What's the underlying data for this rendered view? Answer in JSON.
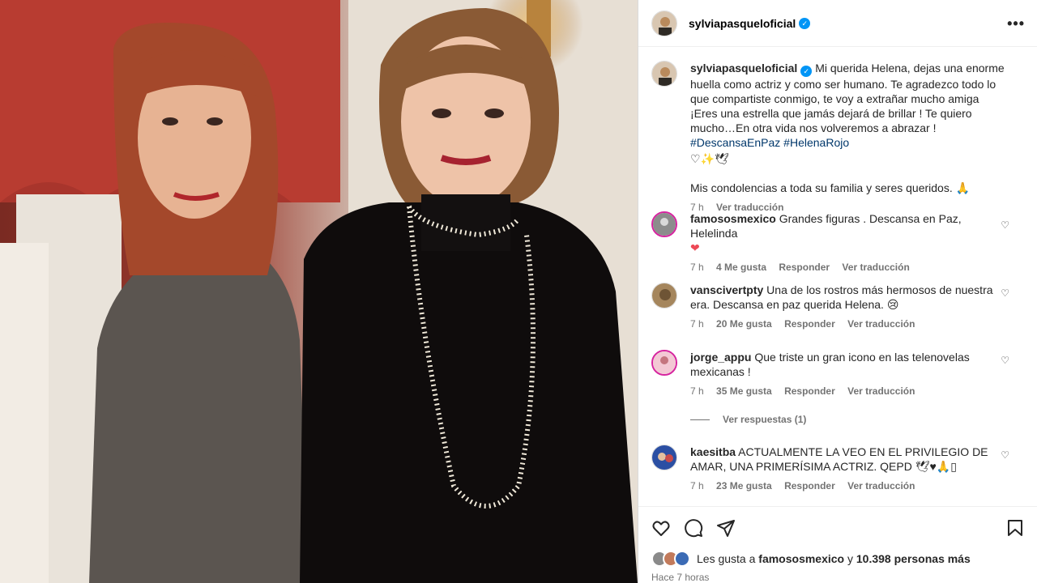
{
  "post": {
    "author": "sylviapasqueloficial",
    "verified_glyph": "✓",
    "more_label": "•••",
    "caption": {
      "text": "Mi querida Helena, dejas una enorme huella como actriz y como ser humano. Te agradezco todo lo que compartiste conmigo, te voy a extrañar mucho amiga ¡Eres una estrella que jamás dejará de brillar ! Te quiero mucho…En otra vida nos volveremos a abrazar !",
      "hashtags": "#DescansaEnPaz #HelenaRojo",
      "emoji_line": "♡✨🕊",
      "second_para": "Mis condolencias a toda su familia y seres queridos. 🙏",
      "time": "7 h",
      "translate": "Ver traducción"
    }
  },
  "comments": [
    {
      "user": "famososmexico",
      "text": "Grandes figuras . Descansa en Paz, Helelinda",
      "emoji": "❤",
      "time": "7 h",
      "likes": "4 Me gusta",
      "reply": "Responder",
      "translate": "Ver traducción"
    },
    {
      "user": "vanscivertpty",
      "text": "Una de los rostros más hermosos de nuestra era. Descansa en paz querida Helena. 😢",
      "time": "7 h",
      "likes": "20 Me gusta",
      "reply": "Responder",
      "translate": "Ver traducción"
    },
    {
      "user": "jorge_appu",
      "text": "Que triste un gran icono en las telenovelas mexicanas !",
      "time": "7 h",
      "likes": "35 Me gusta",
      "reply": "Responder",
      "translate": "Ver traducción",
      "view_replies": "Ver respuestas (1)"
    },
    {
      "user": "kaesitba",
      "text": "ACTUALMENTE LA VEO EN EL PRIVILEGIO DE AMAR, UNA PRIMERÍSIMA ACTRIZ. QEPD 🕊♥🙏▯",
      "time": "7 h",
      "likes": "23 Me gusta",
      "reply": "Responder",
      "translate": "Ver traducción"
    }
  ],
  "footer": {
    "likes_prefix": "Les gusta a",
    "likes_user": "famososmexico",
    "likes_mid": "y",
    "likes_count": "10.398 personas más",
    "posted": "Hace 7 horas"
  },
  "icons": {
    "like": "heart-icon",
    "comment": "comment-icon",
    "share": "share-icon",
    "save": "bookmark-icon",
    "comment_like": "small-heart-icon"
  },
  "colors": {
    "link": "#00376b",
    "verified": "#0095f6",
    "muted": "#737373",
    "heart_red": "#ed4956"
  }
}
